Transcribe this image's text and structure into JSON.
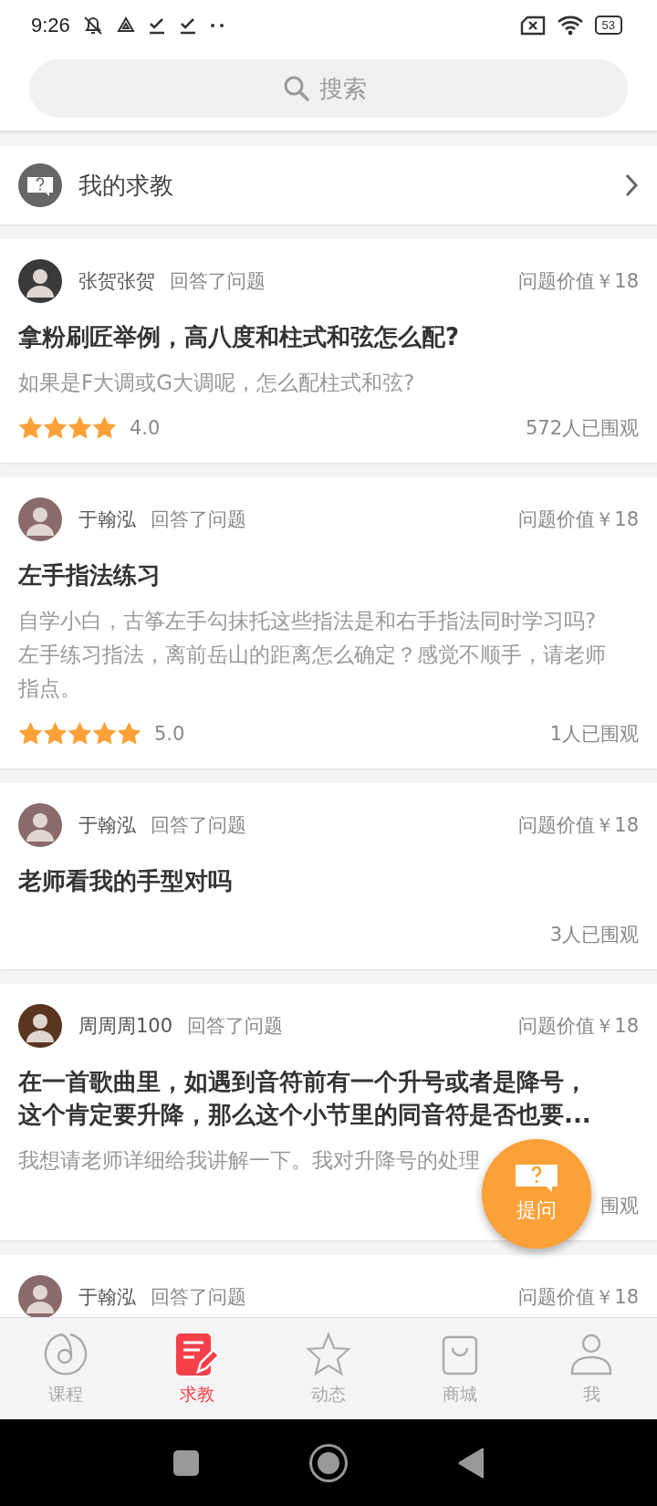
{
  "status_bar": {
    "time": "9:26",
    "battery": "53"
  },
  "search": {
    "placeholder": "搜索"
  },
  "my_questions": {
    "label": "我的求教"
  },
  "questions": [
    {
      "user": "张贺张贺",
      "action": "回答了问题",
      "price": "问题价值￥18",
      "title": "拿粉刷匠举例，高八度和柱式和弦怎么配?",
      "description": "如果是F大调或G大调呢，怎么配柱式和弦?",
      "stars": 4,
      "rating": "4.0",
      "views": "572人已围观"
    },
    {
      "user": "于翰泓",
      "action": "回答了问题",
      "price": "问题价值￥18",
      "title": "左手指法练习",
      "description": "自学小白，古筝左手勾抹托这些指法是和右手指法同时学习吗?左手练习指法，离前岳山的距离怎么确定？感觉不顺手，请老师指点。",
      "stars": 5,
      "rating": "5.0",
      "views": "1人已围观"
    },
    {
      "user": "于翰泓",
      "action": "回答了问题",
      "price": "问题价值￥18",
      "title": "老师看我的手型对吗",
      "views": "3人已围观"
    },
    {
      "user": "周周周100",
      "action": "回答了问题",
      "price": "问题价值￥18",
      "title": "在一首歌曲里，如遇到音符前有一个升号或者是降号，这个肯定要升降，那么这个小节里的同音符是否也要...",
      "description": "我想请老师详细给我讲解一下。我对升降号的处理",
      "views": "围观"
    },
    {
      "user": "于翰泓",
      "action": "回答了问题",
      "price": "问题价值￥18"
    }
  ],
  "ask_button": {
    "label": "提问"
  },
  "tabs": [
    {
      "label": "课程",
      "kind": "course",
      "selected": false
    },
    {
      "label": "求教",
      "kind": "ask",
      "selected": true
    },
    {
      "label": "动态",
      "kind": "feed",
      "selected": false
    },
    {
      "label": "商城",
      "kind": "shop",
      "selected": false
    },
    {
      "label": "我",
      "kind": "me",
      "selected": false
    }
  ]
}
